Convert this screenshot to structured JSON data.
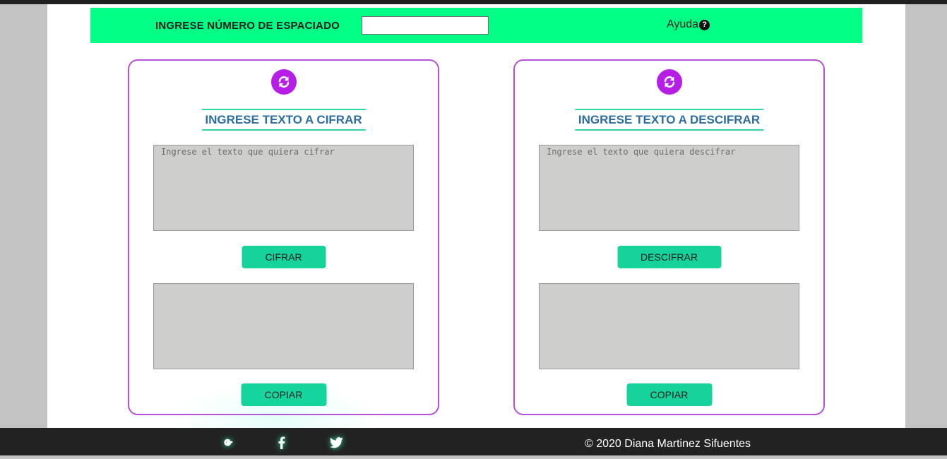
{
  "header": {
    "spacing_label": "INGRESE NÚMERO DE ESPACIADO",
    "spacing_value": "",
    "help_label": "Ayuda"
  },
  "cipher_panel": {
    "title": "INGRESE TEXTO A CIFRAR",
    "input_placeholder": "Ingrese el texto que quiera cifrar",
    "action_label": "CIFRAR",
    "copy_label": "COPIAR"
  },
  "decipher_panel": {
    "title": "INGRESE TEXTO A DESCIFRAR",
    "input_placeholder": "Ingrese el texto que quiera descifrar",
    "action_label": "DESCIFRAR",
    "copy_label": "COPIAR"
  },
  "footer": {
    "copyright": "© 2020 Diana Martinez Sifuentes",
    "social_icons": [
      "google-icon",
      "facebook-icon",
      "twitter-icon"
    ]
  },
  "colors": {
    "header_bg": "#00ff84",
    "card_border": "#b84fd8",
    "reset_icon_bg": "#b61ee6",
    "title_text": "#2e6e9e",
    "title_rule": "#2bd79f",
    "button_bg": "#16d39c",
    "textarea_bg": "#cececc",
    "footer_bg": "#222222"
  }
}
